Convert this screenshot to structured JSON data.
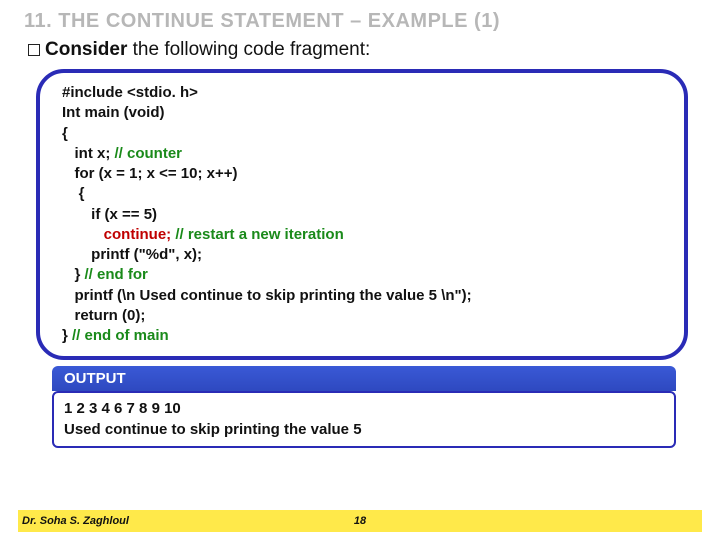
{
  "title": "11. THE CONTINUE STATEMENT – EXAMPLE (1)",
  "consider_prefix": "Consider",
  "consider_rest": " the following code fragment:",
  "code": {
    "l1": "#include <stdio. h>",
    "l2": "Int main (void)",
    "l3": "{",
    "l4a": "   int x; ",
    "l4b": "// counter",
    "l5": "   for (x = 1; x <= 10; x++)",
    "l6": "    {",
    "l7": "       if (x == 5)",
    "l8a": "          continue; ",
    "l8b": "// restart a new iteration",
    "l9": "       printf (\"%d\", x);",
    "l10a": "   } ",
    "l10b": "// end for",
    "l11": "   printf (\\n Used continue to skip printing the value 5 \\n\");",
    "l12": "   return (0);",
    "l13a": "} ",
    "l13b": "// end of main"
  },
  "output_label": "OUTPUT",
  "output_line1": "1 2 3 4 6 7 8 9 10",
  "output_line2": "Used continue to skip printing the value 5",
  "author": "Dr. Soha S. Zaghloul",
  "page_number": "18"
}
